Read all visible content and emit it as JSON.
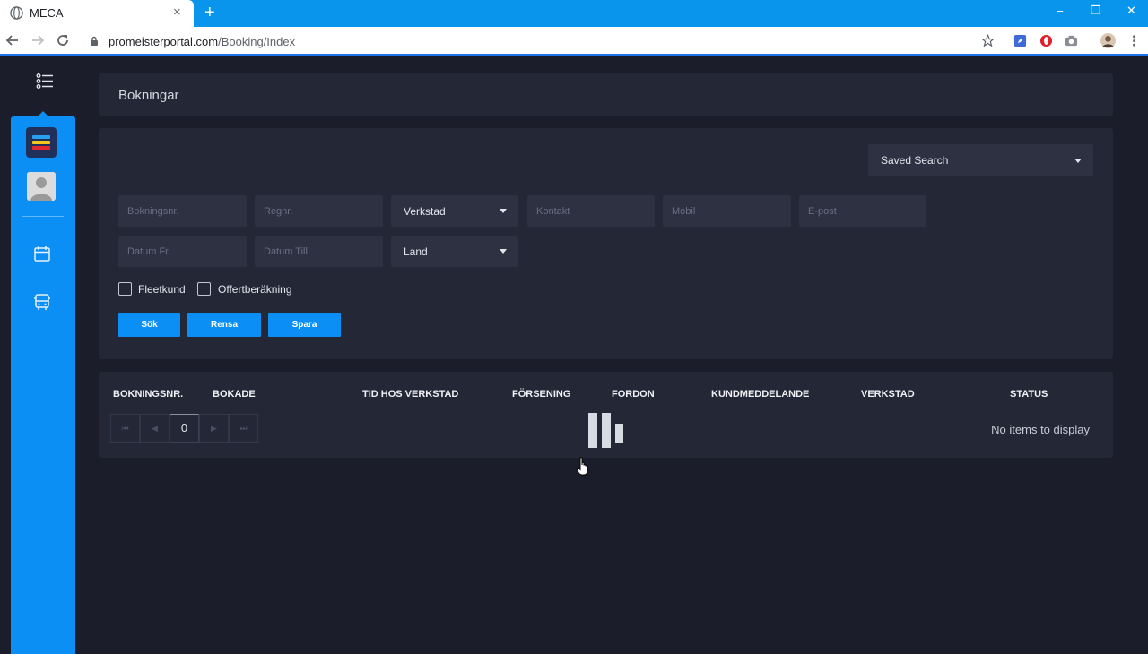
{
  "browser": {
    "tab_title": "MECA",
    "tab_close": "×",
    "new_tab": "+",
    "url_domain": "promeisterportal.com",
    "url_path": "/Booking/Index",
    "window_controls": [
      "–",
      "❐",
      "✕"
    ]
  },
  "page": {
    "title": "Bokningar"
  },
  "search": {
    "saved_search": "Saved Search",
    "placeholders": {
      "bokningsnr": "Bokningsnr.",
      "regnr": "Regnr.",
      "kontakt": "Kontakt",
      "mobil": "Mobil",
      "epost": "E-post",
      "datum_fr": "Datum Fr.",
      "datum_till": "Datum Till"
    },
    "verkstad_select": "Verkstad",
    "land_select": "Land",
    "checkboxes": {
      "fleetkund": "Fleetkund",
      "offertberakning": "Offertberäkning"
    },
    "buttons": {
      "search": "Sök",
      "clear": "Rensa",
      "save": "Spara"
    }
  },
  "table": {
    "columns": [
      "BOKNINGSNR.",
      "BOKADE",
      "TID HOS VERKSTAD",
      "FÖRSENING",
      "FORDON",
      "KUNDMEDDELANDE",
      "VERKSTAD",
      "STATUS"
    ],
    "pager": {
      "first": "⏮",
      "prev": "◀",
      "current_page": "0",
      "next": "▶",
      "last": "⏭"
    },
    "empty_message": "No items to display"
  },
  "colors": {
    "sidebar": "#0b8ff5",
    "background": "#1b1d2a",
    "panel": "#242736",
    "accent_button": "#0b8ff5"
  }
}
